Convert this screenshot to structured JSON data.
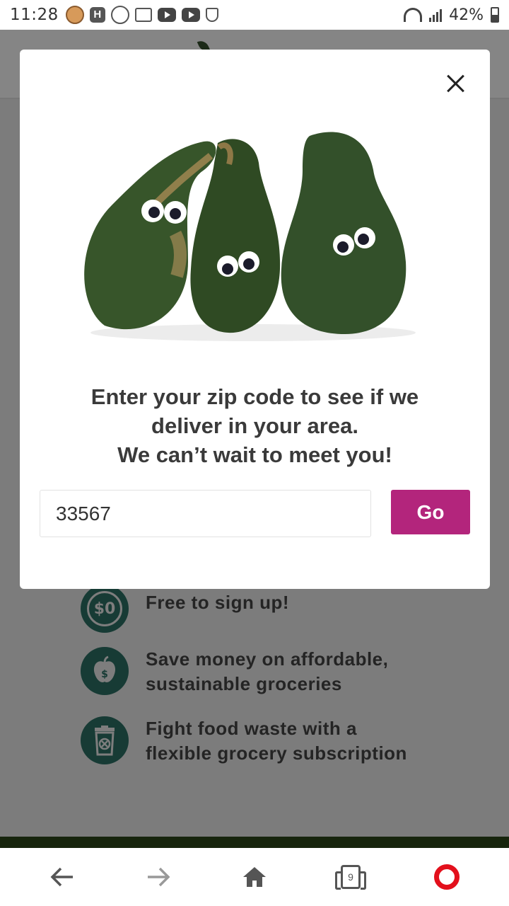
{
  "status_bar": {
    "time": "11:28",
    "battery": "42%",
    "icons": [
      "avatar-icon",
      "h-app-icon",
      "toon-blast-icon",
      "gallery-icon",
      "youtube-icon",
      "youtube-icon",
      "shield-icon",
      "wifi-icon",
      "signal-icon",
      "battery-icon"
    ]
  },
  "modal": {
    "message_line1": "Enter your zip code to see if we",
    "message_line2": "deliver in your area.",
    "message_line3": "We can’t wait to meet you!",
    "zip_value": "33567",
    "go_label": "Go",
    "close_icon": "close-icon"
  },
  "features": [
    {
      "icon": "dollar-zero-icon",
      "icon_text": "$0",
      "line1": "Free to sign up!",
      "line2": ""
    },
    {
      "icon": "apple-money-icon",
      "icon_text": "",
      "line1": "Save money on affordable,",
      "line2": "sustainable groceries"
    },
    {
      "icon": "trash-bin-icon",
      "icon_text": "",
      "line1": "Fight food waste with a",
      "line2": "flexible grocery subscription"
    }
  ],
  "bottom_nav": {
    "items": [
      "back-arrow-icon",
      "forward-arrow-icon",
      "home-icon",
      "tabs-icon",
      "opera-icon"
    ],
    "tab_count": "9"
  },
  "colors": {
    "accent": "#b3257c",
    "feature_icon": "#173b35",
    "opera": "#e3101c"
  }
}
